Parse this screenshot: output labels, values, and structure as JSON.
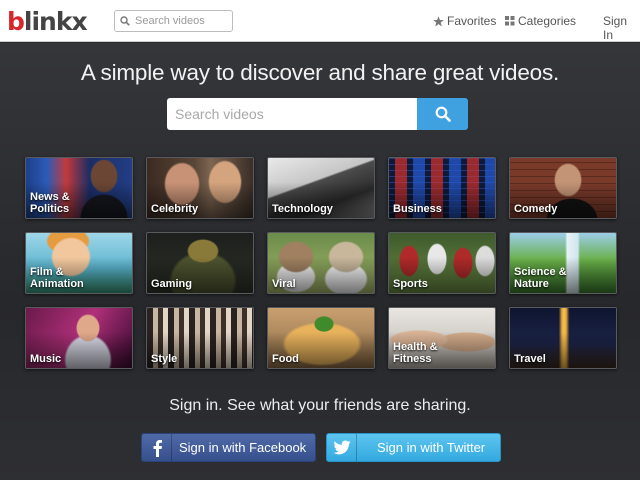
{
  "header": {
    "logo": {
      "first": "b",
      "rest": "linkx"
    },
    "search_placeholder": "Search videos",
    "favorites": "Favorites",
    "categories": "Categories",
    "sign_in": "Sign In"
  },
  "main": {
    "headline": "A simple way to discover and share great videos.",
    "search_placeholder": "Search videos",
    "categories": [
      {
        "label": "News &\nPolitics"
      },
      {
        "label": "Celebrity"
      },
      {
        "label": "Technology"
      },
      {
        "label": "Business"
      },
      {
        "label": "Comedy"
      },
      {
        "label": "Film &\nAnimation"
      },
      {
        "label": "Gaming"
      },
      {
        "label": "Viral"
      },
      {
        "label": "Sports"
      },
      {
        "label": "Science &\nNature"
      },
      {
        "label": "Music"
      },
      {
        "label": "Style"
      },
      {
        "label": "Food"
      },
      {
        "label": "Health &\nFitness"
      },
      {
        "label": "Travel"
      }
    ],
    "signin_prompt": "Sign in. See what your friends are sharing.",
    "facebook_button": "Sign in with Facebook",
    "twitter_button": "Sign in with Twitter"
  },
  "colors": {
    "brand_red": "#d9262b",
    "accent_blue": "#3fa1e0",
    "facebook_blue": "#3b5998",
    "twitter_blue": "#44b6e8"
  },
  "icons": [
    "search-icon",
    "star-icon",
    "grid-icon",
    "facebook-icon",
    "twitter-icon"
  ]
}
